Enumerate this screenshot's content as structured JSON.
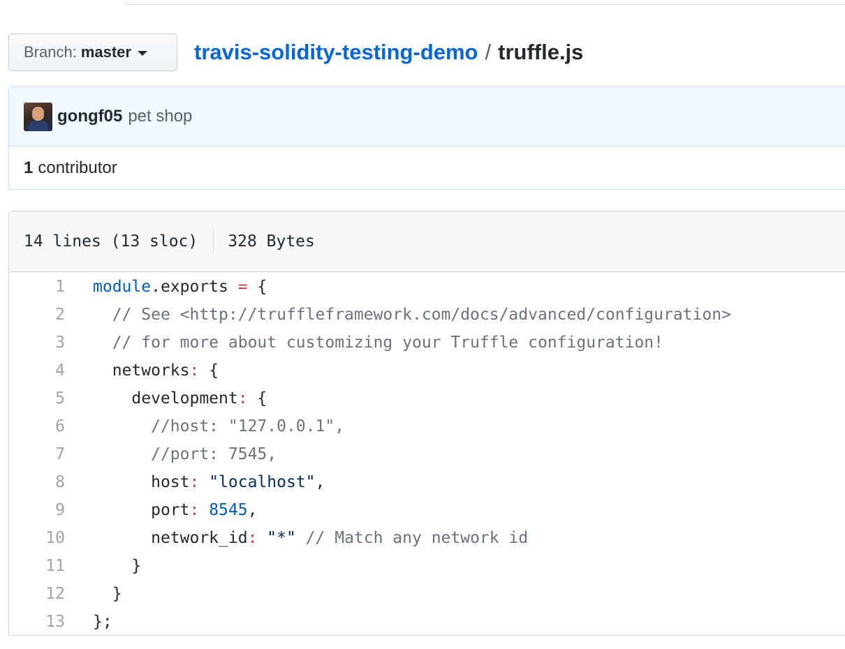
{
  "branch": {
    "prefix": "Branch:",
    "name": "master"
  },
  "breadcrumb": {
    "repo": "travis-solidity-testing-demo",
    "separator": "/",
    "file": "truffle.js"
  },
  "commit": {
    "author": "gongf05",
    "message": "pet shop"
  },
  "contributors": {
    "count": "1",
    "label": "contributor"
  },
  "file_info": {
    "lines": "14 lines (13 sloc)",
    "size": "328 Bytes"
  },
  "code": {
    "line_numbers": [
      "1",
      "2",
      "3",
      "4",
      "5",
      "6",
      "7",
      "8",
      "9",
      "10",
      "11",
      "12",
      "13"
    ],
    "l1": {
      "module": "module",
      "dot_exports": ".exports ",
      "eq": "=",
      "brace": " {"
    },
    "l2": {
      "comment": "// See <http://truffleframework.com/docs/advanced/configuration>"
    },
    "l3": {
      "comment": "// for more about customizing your Truffle configuration!"
    },
    "l4": {
      "key": "networks",
      "colon": ":",
      "brace": " {"
    },
    "l5": {
      "key": "development",
      "colon": ":",
      "brace": " {"
    },
    "l6": {
      "comment": "//host: \"127.0.0.1\","
    },
    "l7": {
      "comment": "//port: 7545,"
    },
    "l8": {
      "key": "host",
      "colon": ":",
      "string": " \"localhost\"",
      "comma": ","
    },
    "l9": {
      "key": "port",
      "colon": ":",
      "number": " 8545",
      "comma": ","
    },
    "l10": {
      "key": "network_id",
      "colon": ":",
      "string": " \"*\"",
      "comment": " // Match any network id"
    },
    "l11": {
      "text": "}"
    },
    "l12": {
      "text": "}"
    },
    "l13": {
      "text": "};"
    }
  },
  "colors": {
    "link": "#0366d6",
    "keyword": "#005cc5",
    "operator": "#d73a49",
    "comment": "#6a737d",
    "string": "#032f62",
    "commit_bg": "#f1f8ff"
  }
}
